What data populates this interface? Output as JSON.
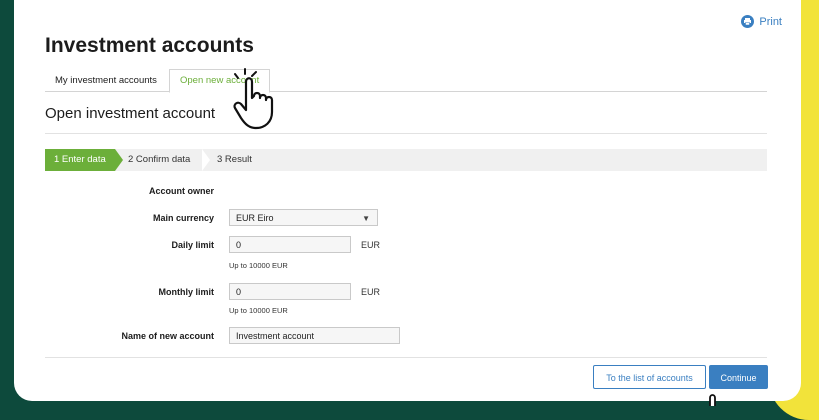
{
  "header": {
    "print_label": "Print",
    "title": "Investment accounts"
  },
  "tabs": [
    {
      "label": "My investment accounts"
    },
    {
      "label": "Open new account"
    }
  ],
  "section": {
    "title": "Open investment account"
  },
  "steps": [
    {
      "label": "1  Enter data",
      "active": true
    },
    {
      "label": "2  Confirm data",
      "active": false
    },
    {
      "label": "3  Result",
      "active": false
    }
  ],
  "form": {
    "account_owner_label": "Account owner",
    "main_currency_label": "Main currency",
    "main_currency_value": "EUR Eiro",
    "daily_limit_label": "Daily limit",
    "daily_limit_value": "0",
    "daily_limit_unit": "EUR",
    "daily_limit_hint": "Up to 10000 EUR",
    "monthly_limit_label": "Monthly limit",
    "monthly_limit_value": "0",
    "monthly_limit_unit": "EUR",
    "monthly_limit_hint": "Up to 10000 EUR",
    "new_account_name_label": "Name of new account",
    "new_account_name_value": "Investment account"
  },
  "actions": {
    "list_label": "To the list of accounts",
    "continue_label": "Continue"
  },
  "colors": {
    "accent_green": "#6caf3a",
    "link_blue": "#3a7fc1",
    "background": "#0d4a3c",
    "stripe": "#f2e33a"
  }
}
